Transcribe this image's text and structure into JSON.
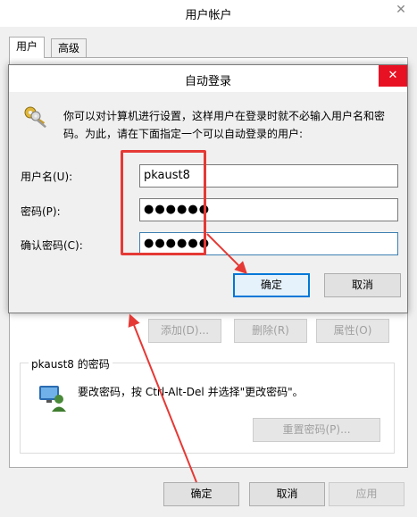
{
  "outer": {
    "title": "用户帐户",
    "close_glyph": "✕",
    "tabs": [
      "用户",
      "高级"
    ],
    "buttons": {
      "add": "添加(D)...",
      "delete": "删除(R)",
      "properties": "属性(O)"
    },
    "password_group": {
      "title": "pkaust8 的密码",
      "text": "要改密码，按 Ctrl-Alt-Del 并选择\"更改密码\"。",
      "reset_button": "重置密码(P)..."
    },
    "footer": {
      "ok": "确定",
      "cancel": "取消",
      "apply": "应用"
    }
  },
  "dialog": {
    "title": "自动登录",
    "close_glyph": "✕",
    "description": "你可以对计算机进行设置，这样用户在登录时就不必输入用户名和密码。为此，请在下面指定一个可以自动登录的用户:",
    "fields": {
      "username_label": "用户名(U):",
      "username_value": "pkaust8",
      "password_label": "密码(P):",
      "password_value": "●●●●●●",
      "confirm_label": "确认密码(C):",
      "confirm_value": "●●●●●●"
    },
    "ok": "确定",
    "cancel": "取消",
    "icon": "keys-icon"
  },
  "colors": {
    "annotation": "#e53935",
    "close_button": "#e81123",
    "focus": "#0078d7"
  }
}
